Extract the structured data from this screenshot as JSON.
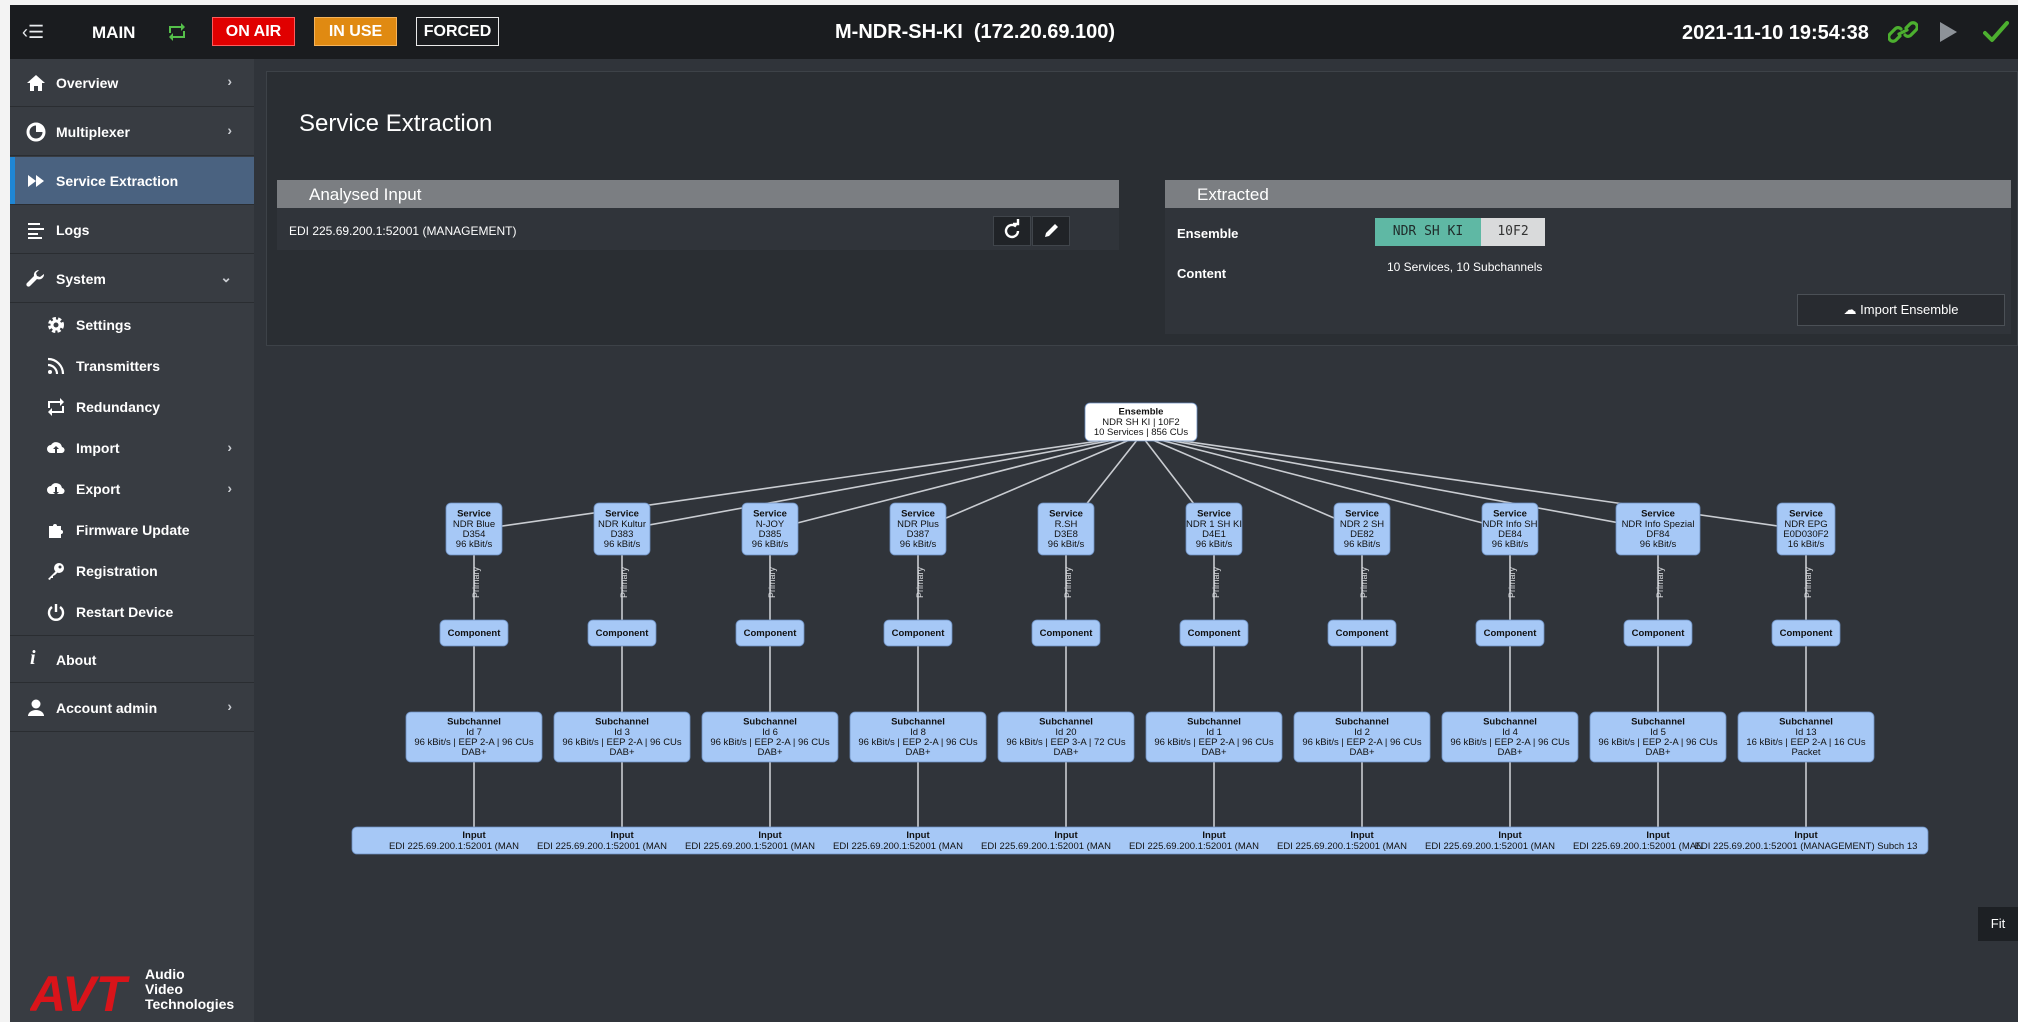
{
  "topbar": {
    "mode": "MAIN",
    "on_air": "ON AIR",
    "in_use": "IN USE",
    "forced": "FORCED",
    "device": "M-NDR-SH-KI  (172.20.69.100)",
    "datetime": "2021-11-10 19:54:38"
  },
  "sidebar": {
    "items": [
      {
        "label": "Overview",
        "icon": "home-icon"
      },
      {
        "label": "Multiplexer",
        "icon": "multiplexer-icon"
      },
      {
        "label": "Service Extraction",
        "icon": "forward-icon"
      },
      {
        "label": "Logs",
        "icon": "logs-icon"
      },
      {
        "label": "System",
        "icon": "wrench-icon"
      }
    ],
    "system_children": [
      {
        "label": "Settings",
        "icon": "gear-icon"
      },
      {
        "label": "Transmitters",
        "icon": "rss-icon"
      },
      {
        "label": "Redundancy",
        "icon": "redundancy-icon"
      },
      {
        "label": "Import",
        "icon": "cloud-upload-icon"
      },
      {
        "label": "Export",
        "icon": "cloud-download-icon"
      },
      {
        "label": "Firmware Update",
        "icon": "puzzle-icon"
      },
      {
        "label": "Registration",
        "icon": "key-icon"
      },
      {
        "label": "Restart Device",
        "icon": "power-icon"
      }
    ],
    "about": "About",
    "account": "Account admin",
    "logo_text": "AVT",
    "logo_tagline": [
      "Audio",
      "Video",
      "Technologies"
    ]
  },
  "page": {
    "title": "Service Extraction",
    "analysed_input": {
      "header": "Analysed Input",
      "source": "EDI 225.69.200.1:52001 (MANAGEMENT)"
    },
    "extracted": {
      "header": "Extracted",
      "ensemble_label": "Ensemble",
      "ensemble_name": "NDR SH KI",
      "ensemble_id": "10F2",
      "content_label": "Content",
      "content_value": "10 Services, 10 Subchannels",
      "import_button": "Import Ensemble"
    },
    "fit_button": "Fit"
  },
  "graph": {
    "ensemble": [
      "Ensemble",
      "NDR SH KI | 10F2",
      "10 Services | 856 CUs"
    ],
    "primary_label": "Primary",
    "component_label": "Component",
    "services": [
      {
        "name": "NDR Blue",
        "sid": "D354",
        "rate": "96 kBit/s",
        "sub_id": "Id 7",
        "sub_info": "96 kBit/s | EEP 2-A | 96 CUs",
        "sub_type": "DAB+",
        "input": "EDI 225.69.200.1:52001 (MAN"
      },
      {
        "name": "NDR Kultur",
        "sid": "D383",
        "rate": "96 kBit/s",
        "sub_id": "Id 3",
        "sub_info": "96 kBit/s | EEP 2-A | 96 CUs",
        "sub_type": "DAB+",
        "input": "EDI 225.69.200.1:52001 (MAN"
      },
      {
        "name": "N-JOY",
        "sid": "D385",
        "rate": "96 kBit/s",
        "sub_id": "Id 6",
        "sub_info": "96 kBit/s | EEP 2-A | 96 CUs",
        "sub_type": "DAB+",
        "input": "EDI 225.69.200.1:52001 (MAN"
      },
      {
        "name": "NDR Plus",
        "sid": "D387",
        "rate": "96 kBit/s",
        "sub_id": "Id 8",
        "sub_info": "96 kBit/s | EEP 2-A | 96 CUs",
        "sub_type": "DAB+",
        "input": "EDI 225.69.200.1:52001 (MAN"
      },
      {
        "name": "R.SH",
        "sid": "D3E8",
        "rate": "96 kBit/s",
        "sub_id": "Id 20",
        "sub_info": "96 kBit/s | EEP 3-A | 72 CUs",
        "sub_type": "DAB+",
        "input": "EDI 225.69.200.1:52001 (MAN"
      },
      {
        "name": "NDR 1 SH KI",
        "sid": "D4E1",
        "rate": "96 kBit/s",
        "sub_id": "Id 1",
        "sub_info": "96 kBit/s | EEP 2-A | 96 CUs",
        "sub_type": "DAB+",
        "input": "EDI 225.69.200.1:52001 (MAN"
      },
      {
        "name": "NDR 2 SH",
        "sid": "DE82",
        "rate": "96 kBit/s",
        "sub_id": "Id 2",
        "sub_info": "96 kBit/s | EEP 2-A | 96 CUs",
        "sub_type": "DAB+",
        "input": "EDI 225.69.200.1:52001 (MAN"
      },
      {
        "name": "NDR Info SH",
        "sid": "DE84",
        "rate": "96 kBit/s",
        "sub_id": "Id 4",
        "sub_info": "96 kBit/s | EEP 2-A | 96 CUs",
        "sub_type": "DAB+",
        "input": "EDI 225.69.200.1:52001 (MAN"
      },
      {
        "name": "NDR Info Spezial",
        "sid": "DF84",
        "rate": "96 kBit/s",
        "sub_id": "Id 5",
        "sub_info": "96 kBit/s | EEP 2-A | 96 CUs",
        "sub_type": "DAB+",
        "input": "EDI 225.69.200.1:52001 (MAN"
      },
      {
        "name": "NDR EPG",
        "sid": "E0D030F2",
        "rate": "16 kBit/s",
        "sub_id": "Id 13",
        "sub_info": "16 kBit/s | EEP 2-A | 16 CUs",
        "sub_type": "Packet",
        "input": "EDI 225.69.200.1:52001 (MANAGEMENT) Subch 13"
      }
    ]
  },
  "colors": {
    "accent": "#1f86d4",
    "node_fill": "#a6c8f6",
    "on_air": "#e00000",
    "in_use": "#e08a12",
    "ok": "#4caf2f"
  }
}
